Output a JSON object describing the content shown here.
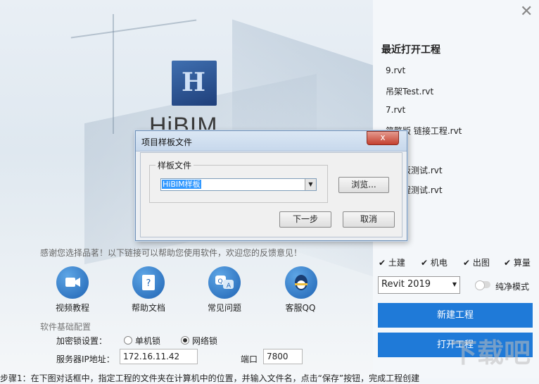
{
  "app": {
    "logo_text": "HiBIM"
  },
  "recent": {
    "title": "最近打开工程",
    "items": [
      "9.rvt",
      "吊架Test.rvt",
      "7.rvt",
      "简繁版 链接工程.rvt",
      "齐梁板测试.rvt",
      "板工程测试.rvt"
    ]
  },
  "dialog": {
    "title": "项目样板文件",
    "close": "x",
    "group_label": "样板文件",
    "template_value": "HiBIM样板",
    "browse": "浏览...",
    "next": "下一步",
    "cancel": "取消"
  },
  "help": {
    "thanks": "感谢您选择品茗！以下链接可以帮助您使用软件，欢迎您的反馈意见！",
    "items": [
      {
        "label": "视频教程",
        "icon": "video-icon"
      },
      {
        "label": "帮助文档",
        "icon": "document-icon"
      },
      {
        "label": "常见问题",
        "icon": "faq-icon"
      },
      {
        "label": "客服QQ",
        "icon": "qq-icon"
      }
    ]
  },
  "config": {
    "section_title": "软件基础配置",
    "lock_label": "加密锁设置：",
    "lock_options": [
      "单机锁",
      "网络锁"
    ],
    "lock_selected": "网络锁",
    "server_label": "服务器IP地址：",
    "server_ip": "172.16.11.42",
    "port_label": "端口",
    "port_value": "7800"
  },
  "modules": {
    "items": [
      "土建",
      "机电",
      "出图",
      "算量"
    ],
    "checked": [
      true,
      true,
      true,
      true
    ]
  },
  "revit": {
    "selected": "Revit 2019"
  },
  "pure_mode": {
    "label": "纯净模式",
    "on": false
  },
  "buttons": {
    "new_project": "新建工程",
    "open_project": "打开工程"
  },
  "footer": {
    "text": "步骤1：在下图对话框中，指定工程的文件夹在计算机中的位置，并输入文件名，点击“保存”按钮，完成工程创建"
  },
  "watermark": {
    "text": "下载吧"
  },
  "colors": {
    "accent": "#1f7ad8",
    "dialog_border": "#6e8fb5"
  }
}
